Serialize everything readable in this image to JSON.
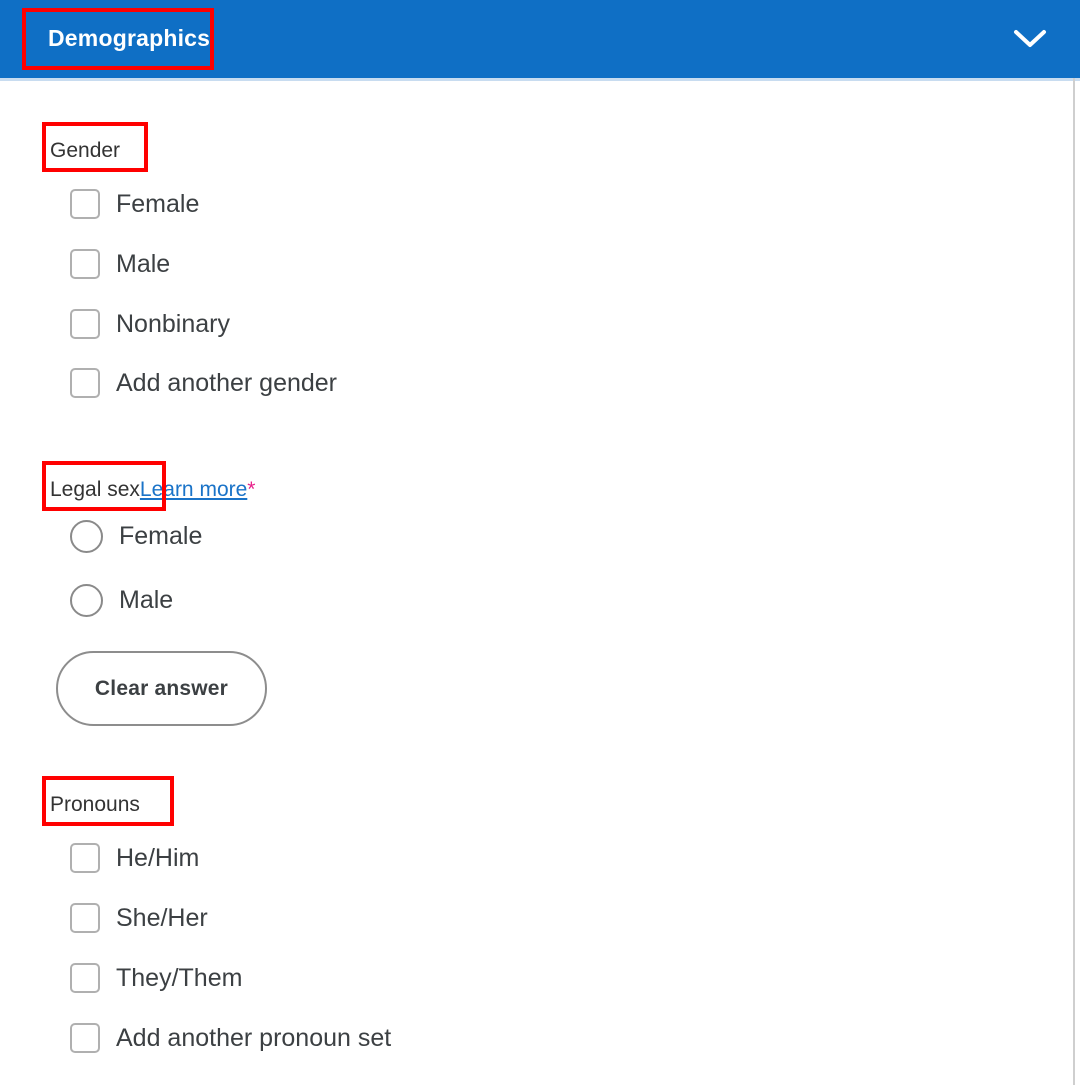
{
  "section": {
    "title": "Demographics",
    "header_color": "#0f6fc5",
    "collapse_icon": "chevron-down-icon"
  },
  "annotation": {
    "color": "#ff0000",
    "boxes": [
      "Demographics",
      "Gender",
      "Legal sex",
      "Pronouns"
    ]
  },
  "fields": {
    "gender": {
      "label": "Gender",
      "type": "checkbox",
      "options": [
        {
          "label": "Female",
          "checked": false
        },
        {
          "label": "Male",
          "checked": false
        },
        {
          "label": "Nonbinary",
          "checked": false
        },
        {
          "label": "Add another gender",
          "checked": false
        }
      ]
    },
    "legal_sex": {
      "label": "Legal sex",
      "link_text": "Learn more",
      "required_marker": "*",
      "required_marker_color": "#e8208a",
      "link_color": "#1a73c8",
      "type": "radio",
      "options": [
        {
          "label": "Female",
          "selected": false
        },
        {
          "label": "Male",
          "selected": false
        }
      ],
      "clear_button_label": "Clear answer"
    },
    "pronouns": {
      "label": "Pronouns",
      "type": "checkbox",
      "options": [
        {
          "label": "He/Him",
          "checked": false
        },
        {
          "label": "She/Her",
          "checked": false
        },
        {
          "label": "They/Them",
          "checked": false
        },
        {
          "label": "Add another pronoun set",
          "checked": false
        }
      ]
    }
  }
}
